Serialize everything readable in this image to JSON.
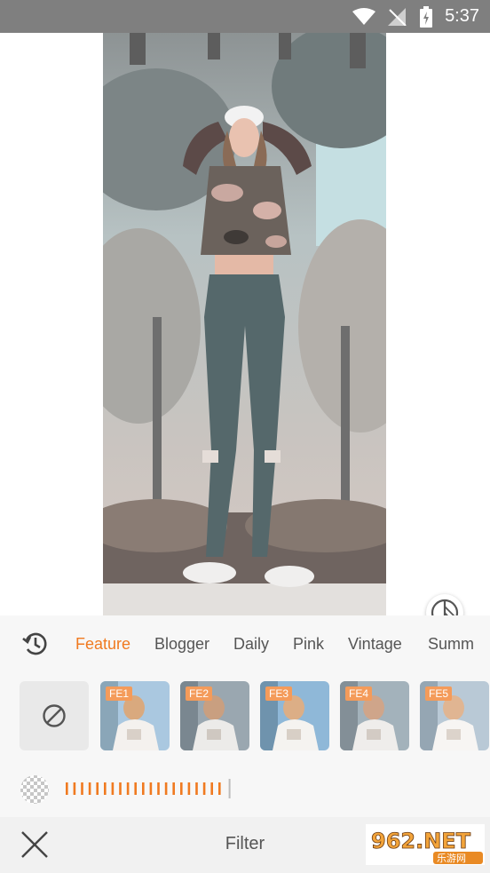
{
  "status_bar": {
    "time": "5:37",
    "background": "#7f7f7f"
  },
  "tabs": [
    "Feature",
    "Blogger",
    "Daily",
    "Pink",
    "Vintage",
    "Summ"
  ],
  "active_tab": "Feature",
  "accent_color": "#f07a20",
  "filters": [
    "FE1",
    "FE2",
    "FE3",
    "FE4",
    "FE5"
  ],
  "filter_strength": 0.82,
  "bottom_bar": {
    "title": "Filter"
  },
  "watermark": {
    "main": "962.NET",
    "sub": "乐游网"
  }
}
